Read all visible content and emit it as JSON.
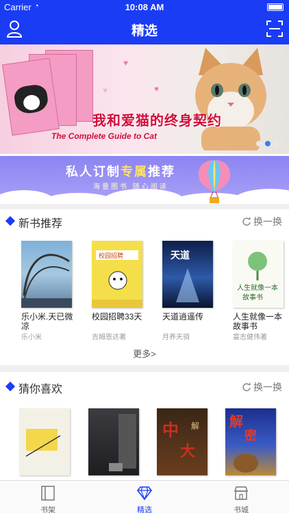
{
  "status": {
    "carrier": "Carrier",
    "time": "10:08 AM"
  },
  "nav": {
    "title": "精选",
    "left_icon": "user-icon",
    "right_icon": "scan-icon"
  },
  "banner": {
    "tagline": "我和爱猫的终身契约",
    "subline": "The Complete Guide to Cat",
    "slides": 3,
    "active_slide": 2
  },
  "promo": {
    "title_a": "私人订制",
    "title_hl": "专属",
    "title_b": "推荐",
    "sub": "海量图书 随心阅读"
  },
  "sections": [
    {
      "label": "新书推荐",
      "refresh": "换一换",
      "books": [
        {
          "title": "乐小米.天已微凉",
          "author": "乐小米"
        },
        {
          "title": "校园招聘33天",
          "author": "吉姆恩达著"
        },
        {
          "title": "天道逍遥传",
          "author": "月养天骑"
        },
        {
          "title": "人生就像一本故事书",
          "author": "富志健伟著"
        }
      ],
      "more": "更多>"
    },
    {
      "label": "猜你喜欢",
      "refresh": "换一换",
      "books": [
        {
          "title": "",
          "author": ""
        },
        {
          "title": "",
          "author": ""
        },
        {
          "title": "",
          "author": ""
        },
        {
          "title": "",
          "author": ""
        }
      ]
    }
  ],
  "tabs": [
    {
      "label": "书架",
      "icon": "bookshelf-icon"
    },
    {
      "label": "精选",
      "icon": "diamond-icon",
      "active": true
    },
    {
      "label": "书城",
      "icon": "store-icon"
    }
  ],
  "colors": {
    "brand": "#1a3cf5",
    "banner_text": "#d10d3a",
    "promo_bg": "#8c84f2"
  }
}
